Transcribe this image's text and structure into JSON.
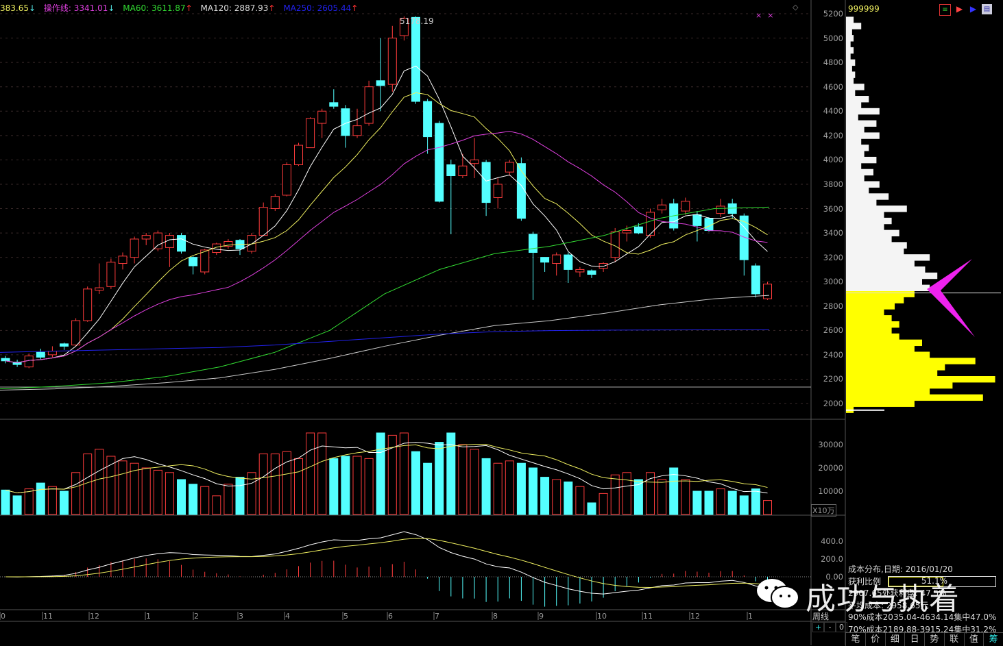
{
  "legend": {
    "ma_short": {
      "text": "383.65",
      "dir": "↓",
      "color": "#f0f060"
    },
    "operate_line": {
      "text": "操作线: 3341.01",
      "dir": "↓",
      "color": "#e040e0"
    },
    "ma60": {
      "text": "MA60: 3611.87",
      "dir": "↑",
      "color": "#33dd33"
    },
    "ma120": {
      "text": "MA120: 2887.93",
      "dir": "↑",
      "color": "#dddddd"
    },
    "ma250": {
      "text": "MA250: 2605.44",
      "dir": "↑",
      "color": "#2222ee"
    }
  },
  "high_label": "5178.19",
  "top_marks": "××",
  "diamond": "◇",
  "price_axis": [
    "5200",
    "5000",
    "4800",
    "4600",
    "4400",
    "4200",
    "4000",
    "3800",
    "3600",
    "3400",
    "3200",
    "3000",
    "2800",
    "2600",
    "2400",
    "2200",
    "2000"
  ],
  "volume_axis": [
    "30000",
    "20000",
    "10000"
  ],
  "volume_unit": "X10万",
  "macd_axis": [
    "400.0",
    "200.0",
    "0.00"
  ],
  "x_axis": [
    "0",
    "11",
    "12",
    "1",
    "2",
    "3",
    "4",
    "5",
    "6",
    "7",
    "8",
    "9",
    "10",
    "11",
    "12",
    "1"
  ],
  "period_label": "周线",
  "zoom_controls": [
    "+",
    "-",
    "0"
  ],
  "right_panel": {
    "code": "999999",
    "icons": [
      "chip-bars-icon",
      "red-arrow-icon",
      "blue-arrow-icon",
      "info-card-icon"
    ],
    "info": {
      "title": "成本分布,日期: 2016/01/20",
      "profit_ratio_label": "获利比例",
      "profit_ratio": "51.1%",
      "profit_ratio_value": 0.511,
      "profit_at": "2907.65处获利盘: 47.5%",
      "avg_cost": "平均成本: 2958.65元",
      "c90": "90%成本2035.04-4634.14集中47.0%",
      "c70": "70%成本2189.88-3915.24集中31.2%"
    },
    "tabs": [
      "笔",
      "价",
      "细",
      "日",
      "势",
      "联",
      "值",
      "筹"
    ],
    "active_tab": "筹"
  },
  "watermark": "成功与执着",
  "colors": {
    "up": "#ff3c3c",
    "down": "#54ffff",
    "ma5": "#ffffff",
    "ma10": "#f0f060",
    "ma20": "#e040e0",
    "ma60": "#33dd33",
    "ma120": "#cccccc",
    "ma250": "#2222ee",
    "chip_profit": "#ffff00",
    "chip_loss": "#f4f4f4",
    "arrow": "#ee22ee"
  },
  "chart_data": {
    "type": "candlestick",
    "period": "weekly",
    "ylim": [
      2000,
      5200
    ],
    "current_price": 2907.65,
    "candles": [
      [
        2370,
        2350,
        2390,
        2330,
        10500
      ],
      [
        2340,
        2320,
        2360,
        2300,
        8000
      ],
      [
        2300,
        2390,
        2410,
        2290,
        11000
      ],
      [
        2420,
        2380,
        2450,
        2360,
        13500
      ],
      [
        2400,
        2430,
        2470,
        2380,
        12000
      ],
      [
        2490,
        2470,
        2500,
        2440,
        10000
      ],
      [
        2480,
        2680,
        2700,
        2470,
        18000
      ],
      [
        2680,
        2940,
        2960,
        2670,
        26000
      ],
      [
        2930,
        2950,
        3150,
        2900,
        28000
      ],
      [
        2960,
        3160,
        3190,
        2940,
        25000
      ],
      [
        3150,
        3210,
        3240,
        3100,
        23000
      ],
      [
        3200,
        3350,
        3370,
        3150,
        22000
      ],
      [
        3350,
        3380,
        3400,
        3300,
        20000
      ],
      [
        3270,
        3400,
        3420,
        3250,
        19000
      ],
      [
        3280,
        3380,
        3400,
        3120,
        18000
      ],
      [
        3380,
        3250,
        3400,
        3230,
        15000
      ],
      [
        3200,
        3130,
        3210,
        3060,
        13000
      ],
      [
        3080,
        3260,
        3270,
        3060,
        12000
      ],
      [
        3240,
        3310,
        3320,
        3220,
        8000
      ],
      [
        3290,
        3330,
        3350,
        3270,
        13000
      ],
      [
        3340,
        3270,
        3350,
        3220,
        16000
      ],
      [
        3250,
        3380,
        3400,
        3230,
        18000
      ],
      [
        3380,
        3610,
        3650,
        3380,
        26000
      ],
      [
        3600,
        3700,
        3720,
        3580,
        26000
      ],
      [
        3710,
        3960,
        3980,
        3700,
        27000
      ],
      [
        3960,
        4120,
        4140,
        3950,
        24000
      ],
      [
        4100,
        4340,
        4350,
        4100,
        35000
      ],
      [
        4300,
        4400,
        4420,
        4180,
        35000
      ],
      [
        4470,
        4440,
        4580,
        4420,
        24000
      ],
      [
        4420,
        4200,
        4450,
        4100,
        25000
      ],
      [
        4200,
        4280,
        4420,
        4180,
        25000
      ],
      [
        4300,
        4600,
        4650,
        4280,
        24000
      ],
      [
        4650,
        4610,
        5000,
        4400,
        35000
      ],
      [
        4620,
        5000,
        5100,
        4560,
        34000
      ],
      [
        5020,
        5160,
        5178,
        4980,
        35000
      ],
      [
        5170,
        4480,
        5178,
        4460,
        27000
      ],
      [
        4480,
        4190,
        4500,
        4050,
        22000
      ],
      [
        4300,
        3660,
        4320,
        3650,
        31000
      ],
      [
        3960,
        3870,
        4000,
        3390,
        35000
      ],
      [
        3870,
        3950,
        4050,
        3850,
        30000
      ],
      [
        3970,
        4000,
        4180,
        3850,
        28000
      ],
      [
        3980,
        3650,
        4000,
        3540,
        24000
      ],
      [
        3690,
        3800,
        3850,
        3600,
        22000
      ],
      [
        3900,
        3980,
        4000,
        3870,
        23000
      ],
      [
        3970,
        3520,
        4020,
        3500,
        22000
      ],
      [
        3390,
        3240,
        3410,
        2850,
        20000
      ],
      [
        3200,
        3160,
        3200,
        3080,
        16000
      ],
      [
        3150,
        3220,
        3240,
        3050,
        15000
      ],
      [
        3220,
        3100,
        3240,
        2990,
        14000
      ],
      [
        3080,
        3100,
        3120,
        3040,
        12000
      ],
      [
        3090,
        3060,
        3100,
        3030,
        5000
      ],
      [
        3110,
        3150,
        3160,
        3080,
        9000
      ],
      [
        3200,
        3410,
        3440,
        3160,
        17000
      ],
      [
        3400,
        3420,
        3460,
        3330,
        18000
      ],
      [
        3450,
        3400,
        3480,
        3390,
        15000
      ],
      [
        3380,
        3570,
        3600,
        3360,
        18000
      ],
      [
        3590,
        3630,
        3680,
        3560,
        15000
      ],
      [
        3640,
        3440,
        3680,
        3420,
        20000
      ],
      [
        3580,
        3660,
        3690,
        3550,
        15000
      ],
      [
        3550,
        3460,
        3580,
        3330,
        10000
      ],
      [
        3520,
        3420,
        3530,
        3410,
        10000
      ],
      [
        3560,
        3620,
        3680,
        3530,
        11000
      ],
      [
        3640,
        3560,
        3680,
        3520,
        10000
      ],
      [
        3540,
        3180,
        3560,
        3050,
        8000
      ],
      [
        3130,
        2900,
        3150,
        2870,
        11000
      ],
      [
        2860,
        2980,
        3000,
        2850,
        6000
      ]
    ],
    "ma60": [
      2120,
      2140,
      2170,
      2220,
      2300,
      2420,
      2600,
      2900,
      3100,
      3230,
      3290,
      3380,
      3520,
      3600,
      3611.87
    ],
    "ma120": [
      2110,
      2120,
      2140,
      2170,
      2210,
      2280,
      2370,
      2470,
      2560,
      2640,
      2680,
      2740,
      2810,
      2860,
      2887.93
    ],
    "ma250": [
      2420,
      2430,
      2440,
      2450,
      2460,
      2480,
      2510,
      2540,
      2570,
      2590,
      2598,
      2602,
      2604,
      2605,
      2605.44
    ],
    "chip_profile": {
      "prices": [
        1950,
        2000,
        2050,
        2100,
        2150,
        2200,
        2250,
        2300,
        2350,
        2400,
        2450,
        2500,
        2550,
        2600,
        2650,
        2700,
        2750,
        2800,
        2850,
        2900,
        2950,
        3000,
        3050,
        3100,
        3150,
        3200,
        3250,
        3300,
        3350,
        3400,
        3450,
        3500,
        3550,
        3600,
        3650,
        3700,
        3750,
        3800,
        3850,
        3900,
        3950,
        4000,
        4050,
        4100,
        4150,
        4200,
        4250,
        4300,
        4350,
        4400,
        4450,
        4500,
        4550,
        4600,
        4650,
        4700,
        4750,
        4800,
        4850,
        4900,
        4950,
        5000,
        5050,
        5100,
        5150
      ],
      "density": [
        0.05,
        0.45,
        0.9,
        0.55,
        0.7,
        0.98,
        0.6,
        0.65,
        0.85,
        0.55,
        0.45,
        0.5,
        0.35,
        0.3,
        0.35,
        0.3,
        0.25,
        0.32,
        0.38,
        0.45,
        0.55,
        0.5,
        0.6,
        0.52,
        0.45,
        0.55,
        0.38,
        0.4,
        0.3,
        0.35,
        0.25,
        0.3,
        0.25,
        0.4,
        0.2,
        0.28,
        0.15,
        0.22,
        0.12,
        0.18,
        0.1,
        0.2,
        0.12,
        0.15,
        0.1,
        0.22,
        0.12,
        0.2,
        0.08,
        0.22,
        0.1,
        0.15,
        0.06,
        0.12,
        0.05,
        0.06,
        0.04,
        0.06,
        0.03,
        0.05,
        0.03,
        0.05,
        0.04,
        0.1,
        0.05
      ]
    }
  }
}
